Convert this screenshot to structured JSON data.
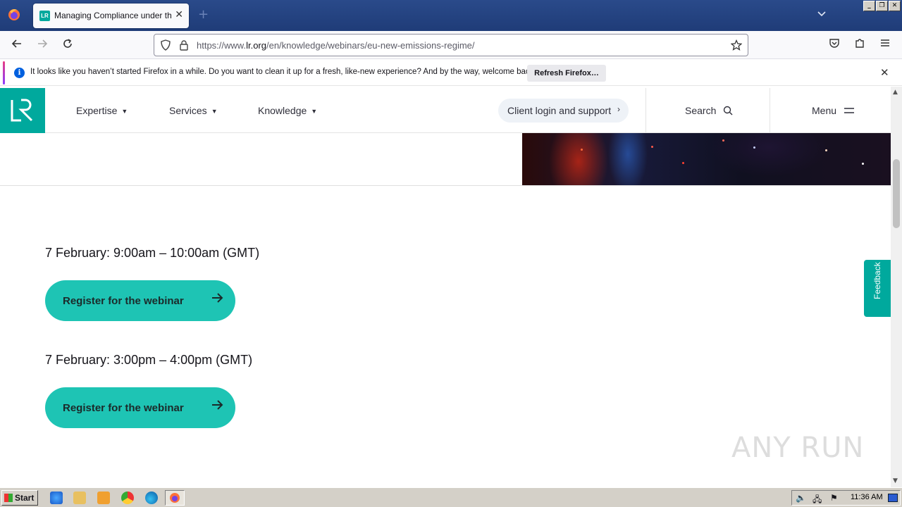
{
  "browser": {
    "tab_title": "Managing Compliance under the EU New Emissions Regime",
    "tab_favicon": "LR",
    "url_prefix": "https://www.",
    "url_domain": "lr.org",
    "url_path": "/en/knowledge/webinars/eu-new-emissions-regime/"
  },
  "notification": {
    "text": "It looks like you haven’t started Firefox in a while. Do you want to clean it up for a fresh, like-new experience? And by the way, welcome back!",
    "button": "Refresh Firefox…",
    "icon": "i"
  },
  "site_header": {
    "nav": [
      {
        "label": "Expertise"
      },
      {
        "label": "Services"
      },
      {
        "label": "Knowledge"
      }
    ],
    "client_login": "Client login and support",
    "search": "Search",
    "menu": "Menu"
  },
  "sessions": [
    {
      "time": "7 February: 9:00am – 10:00am (GMT)",
      "button": "Register for the webinar"
    },
    {
      "time": "7 February: 3:00pm – 4:00pm (GMT)",
      "button": "Register for the webinar"
    }
  ],
  "feedback": "Feedback",
  "watermark": "ANY RUN",
  "taskbar": {
    "start": "Start",
    "clock": "11:36 AM"
  },
  "colors": {
    "brand_teal": "#00a99d",
    "button_teal": "#1ec4b4"
  }
}
